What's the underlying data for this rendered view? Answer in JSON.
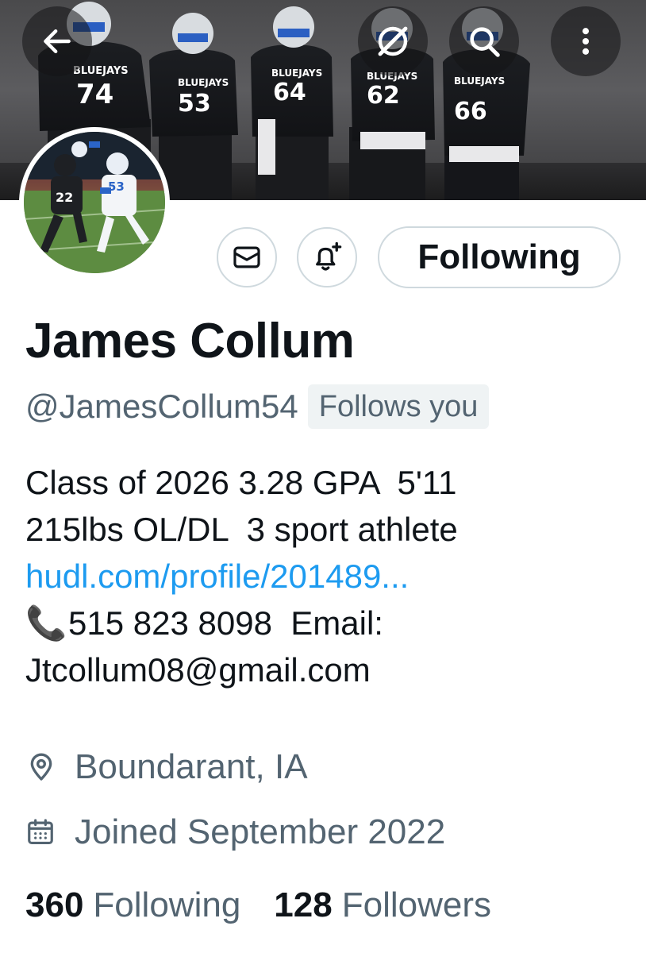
{
  "banner": {
    "players": [
      {
        "team": "BLUEJAYS",
        "number": "74"
      },
      {
        "team": "BLUEJAYS",
        "number": "53"
      },
      {
        "team": "BLUEJAYS",
        "number": "64"
      },
      {
        "team": "BLUEJAYS",
        "number": "62"
      },
      {
        "team": "BLUEJAYS",
        "number": "66"
      }
    ],
    "buttons": {
      "back": "back-arrow-icon",
      "grok": "grok-icon",
      "search": "search-icon",
      "more": "more-vertical-icon"
    }
  },
  "avatar": {
    "jersey_numbers": [
      "22",
      "53"
    ]
  },
  "actions": {
    "message_icon": "envelope-icon",
    "notify_icon": "bell-plus-icon",
    "follow_label": "Following"
  },
  "profile": {
    "name": "James Collum",
    "handle": "@JamesCollum54",
    "follows_you": "Follows you",
    "bio": {
      "line1": "Class of 2026 3.28 GPA  5'11",
      "line2": "215lbs OL/DL  3 sport athlete",
      "link": "hudl.com/profile/201489...",
      "phone_emoji": "📞",
      "line4": "515 823 8098  Email:",
      "line5": "Jtcollum08@gmail.com"
    },
    "location_icon": "location-pin-icon",
    "location": "Boundarant, IA",
    "joined_icon": "calendar-icon",
    "joined": "Joined September 2022"
  },
  "stats": {
    "following_count": "360",
    "following_label": "Following",
    "followers_count": "128",
    "followers_label": "Followers"
  }
}
